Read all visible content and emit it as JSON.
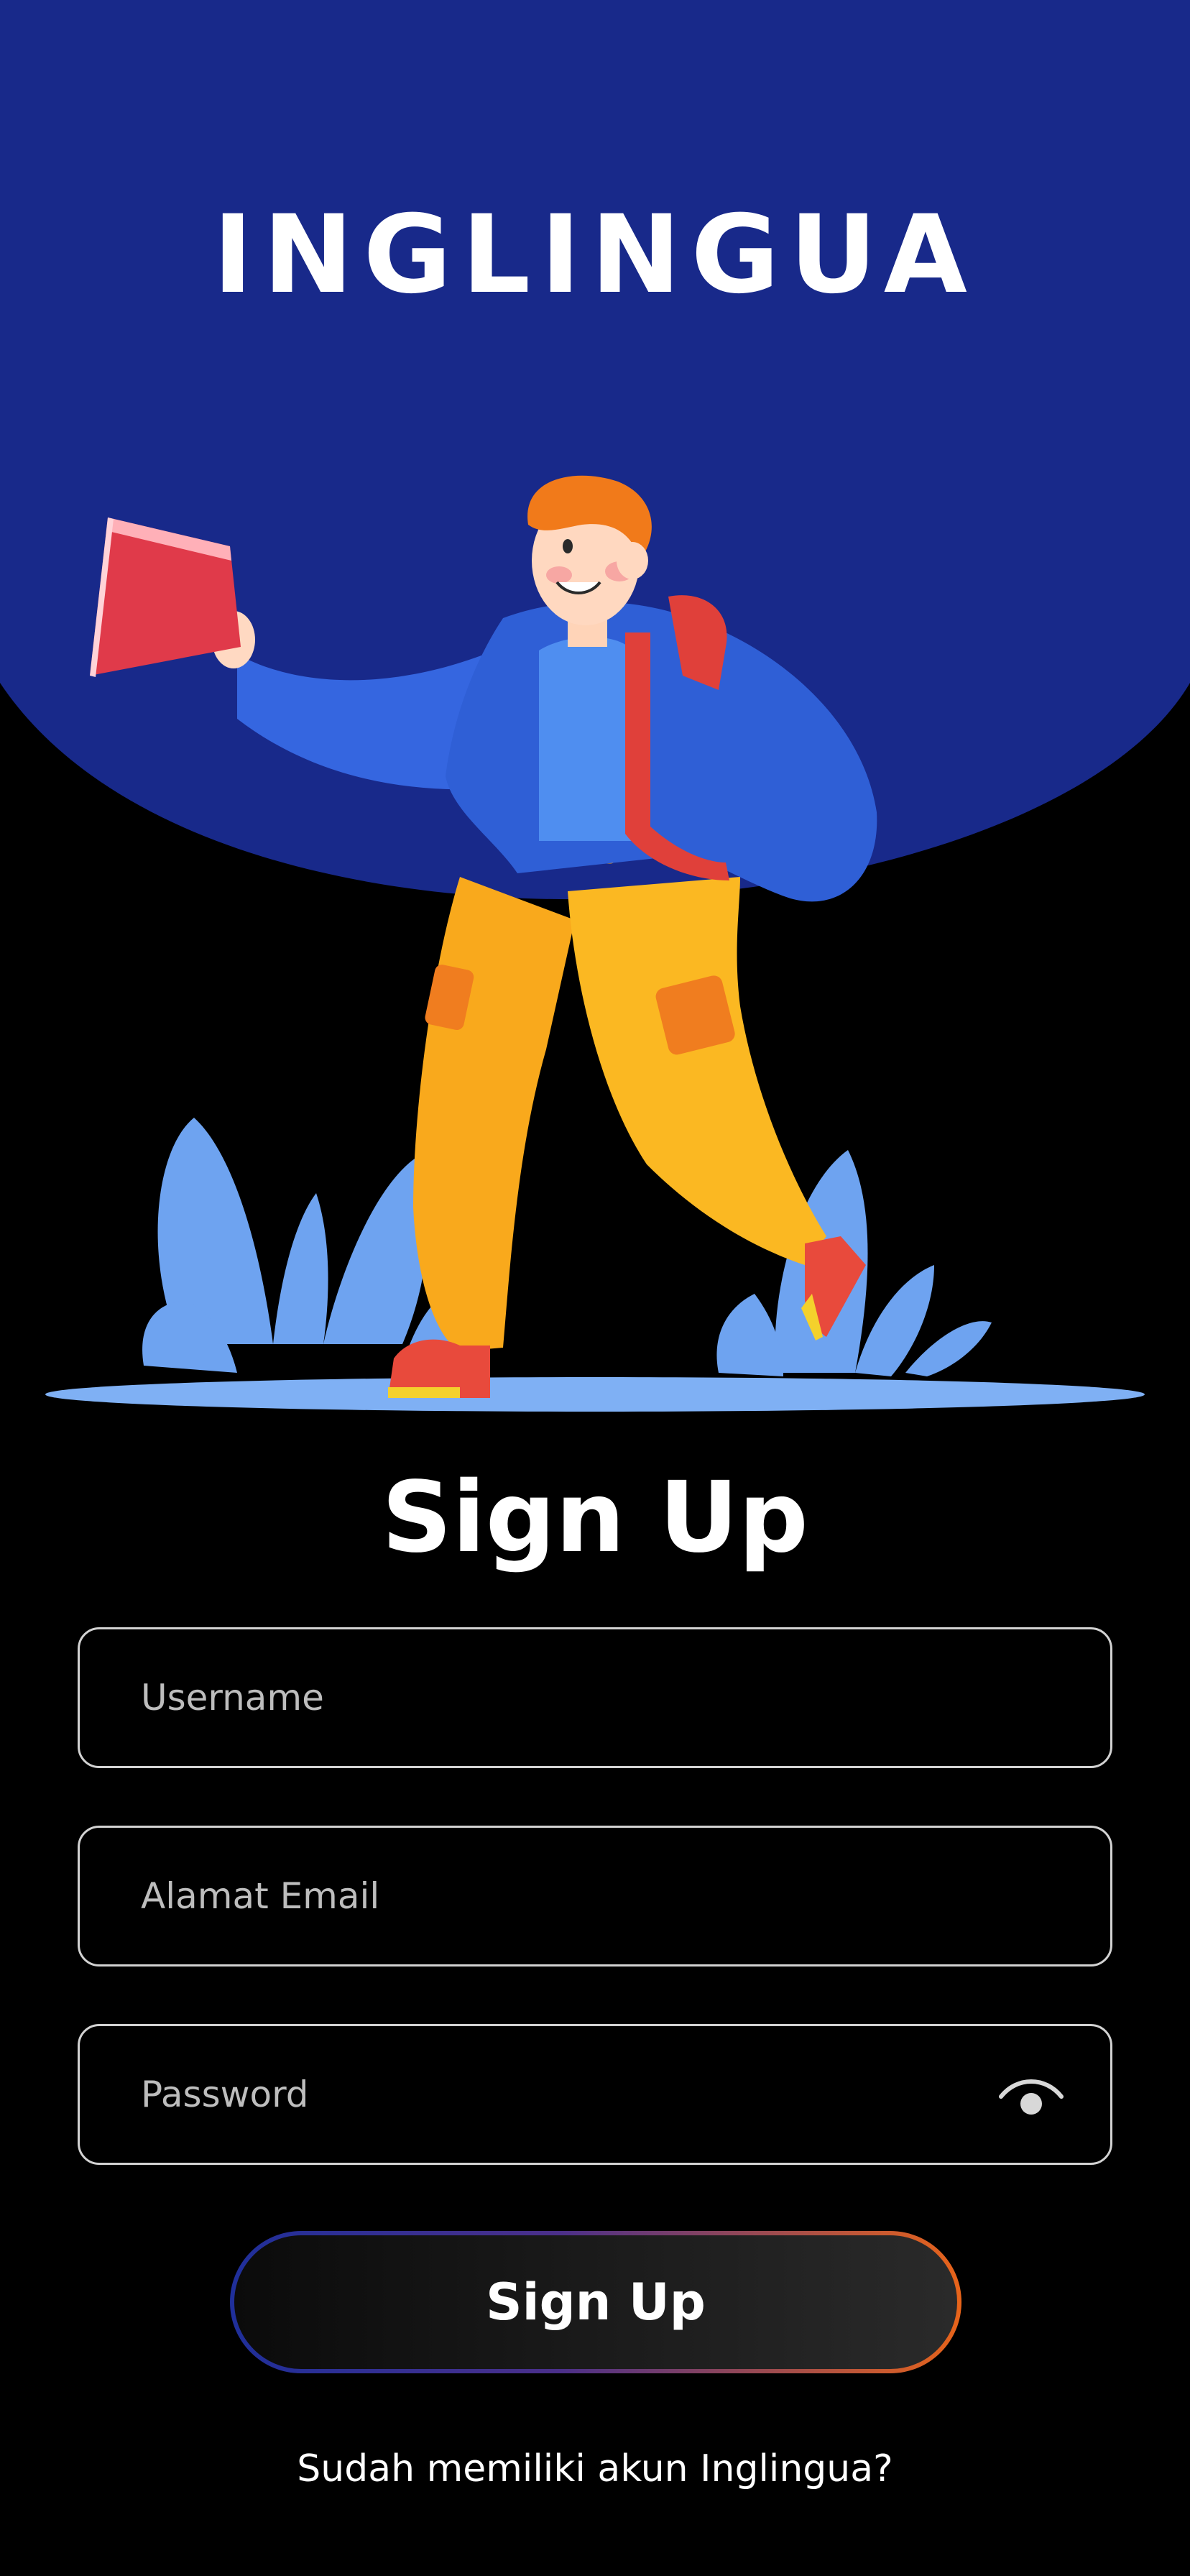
{
  "app": {
    "title": "INGLINGUA"
  },
  "form": {
    "title": "Sign Up",
    "username": {
      "placeholder": "Username",
      "value": ""
    },
    "email": {
      "placeholder": "Alamat Email",
      "value": ""
    },
    "password": {
      "placeholder": "Password",
      "value": "",
      "toggle_icon": "eye-icon"
    },
    "submit_label": "Sign Up",
    "login_prompt": "Sudah memiliki akun Inglingua?"
  },
  "colors": {
    "background": "#000000",
    "hero": "#1a2a8a",
    "text": "#ffffff",
    "field_border": "#d2d2d2",
    "button_gradient_start": "#1f2f9a",
    "button_gradient_end": "#e8641a"
  }
}
